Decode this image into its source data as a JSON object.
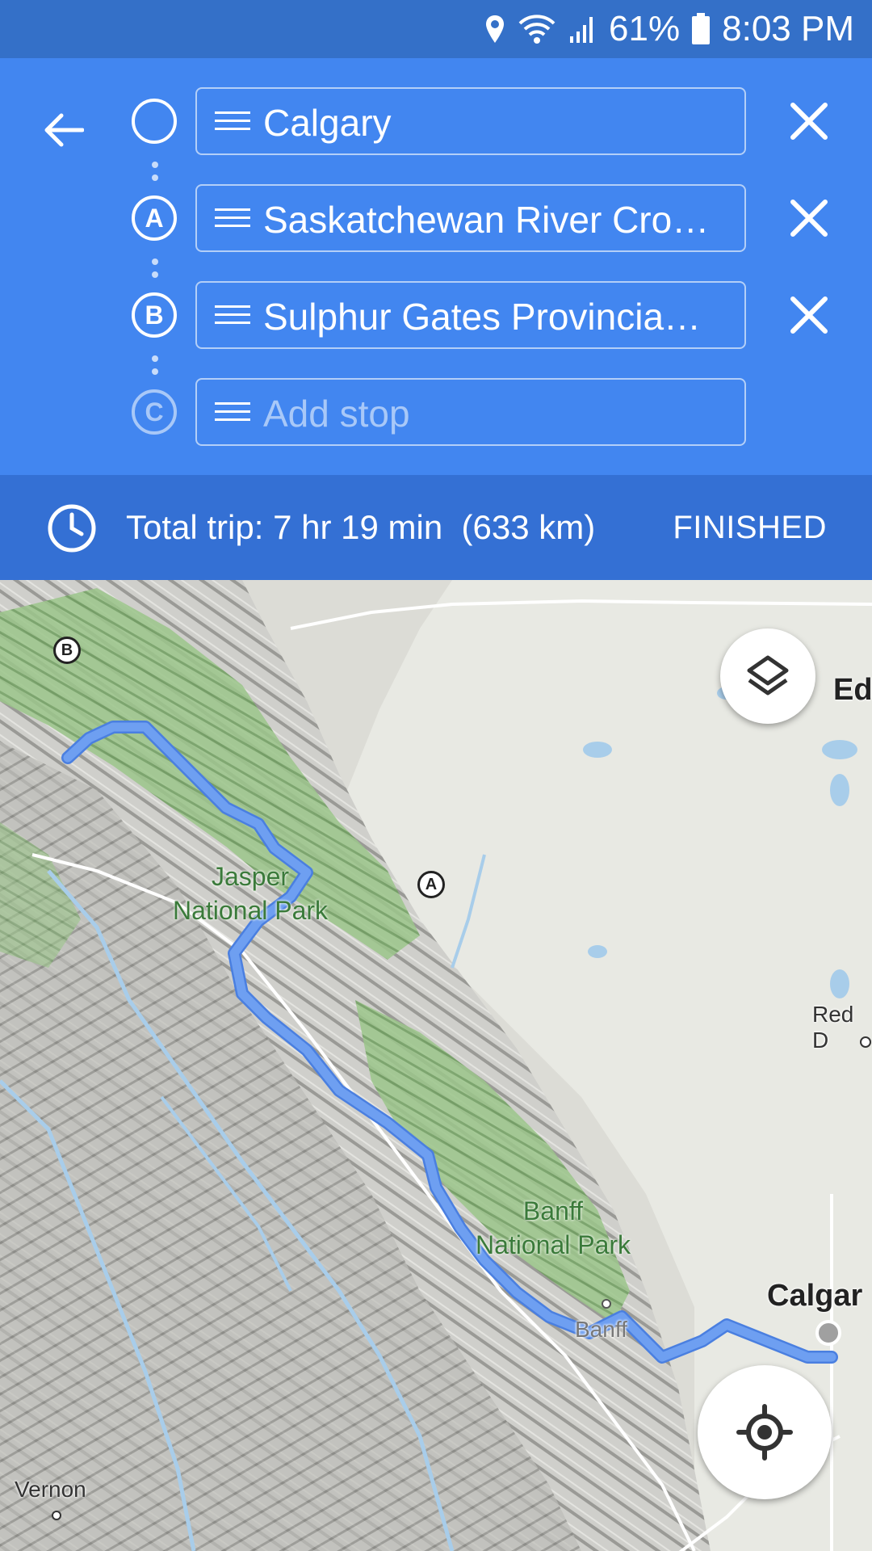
{
  "status_bar": {
    "battery": "61%",
    "time": "8:03 PM"
  },
  "directions": {
    "stops": [
      {
        "marker": "",
        "value": "Calgary"
      },
      {
        "marker": "A",
        "value": "Saskatchewan River Cro…"
      },
      {
        "marker": "B",
        "value": "Sulphur Gates Provincia…"
      }
    ],
    "add_stop": {
      "marker": "C",
      "placeholder": "Add stop"
    }
  },
  "summary": {
    "total_trip": "Total trip: 7 hr 19 min  (633 km)",
    "finished_label": "FINISHED"
  },
  "map": {
    "parks": [
      {
        "line1": "Jasper",
        "line2": "National Park"
      },
      {
        "line1": "Banff",
        "line2": "National Park"
      }
    ],
    "places": {
      "edmonton": "Ed",
      "red_deer": "Red D",
      "calgary": "Calgar",
      "banff": "Banff",
      "vernon": "Vernon"
    },
    "route_markers": {
      "a": "A",
      "b": "B"
    },
    "colors": {
      "route": "#6e9ff1",
      "route_edge": "#4a7fe0",
      "forest": "#9bc58a"
    }
  },
  "icons": {
    "back": "back-arrow-icon",
    "remove": "close-icon",
    "clock": "clock-icon",
    "layers": "layers-icon",
    "my_location": "my-location-icon"
  }
}
